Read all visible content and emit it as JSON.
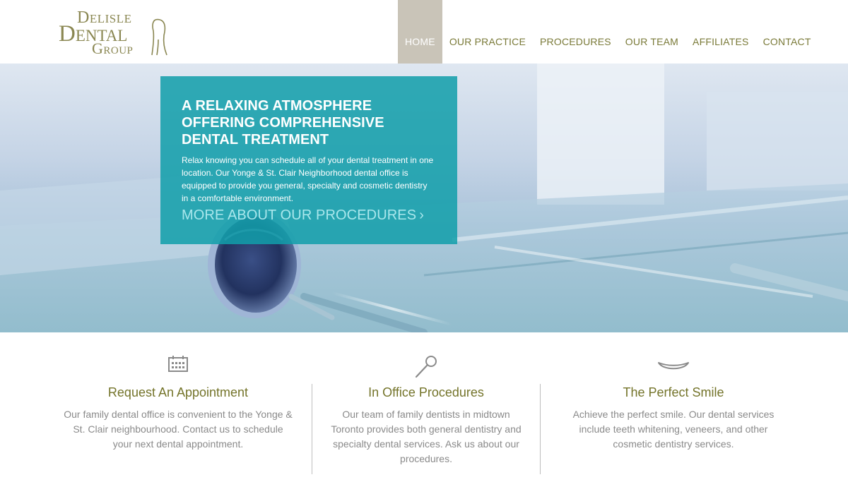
{
  "logo": {
    "line1": "Delisle",
    "line2": "Dental",
    "line3": "Group"
  },
  "nav": {
    "items": [
      {
        "label": "HOME",
        "active": true
      },
      {
        "label": "OUR PRACTICE",
        "active": false
      },
      {
        "label": "PROCEDURES",
        "active": false
      },
      {
        "label": "OUR TEAM",
        "active": false
      },
      {
        "label": "AFFILIATES",
        "active": false
      },
      {
        "label": "CONTACT",
        "active": false
      }
    ]
  },
  "hero": {
    "title": "A RELAXING ATMOSPHERE OFFERING COMPREHENSIVE DENTAL TREATMENT",
    "text": "Relax knowing you can schedule all of your dental treatment in one location. Our Yonge & St. Clair Neighborhood dental office is equipped to provide you general, specialty and cosmetic dentistry in a comfortable environment.",
    "link": "MORE ABOUT OUR PROCEDURES",
    "link_chevron": "›"
  },
  "features": [
    {
      "icon": "calendar-icon",
      "title": "Request An Appointment",
      "text": "Our family dental office is convenient to the Yonge & St. Clair neighbourhood. Contact us to schedule your next dental appointment."
    },
    {
      "icon": "dental-mirror-icon",
      "title": "In Office Procedures",
      "text": "Our team of family dentists in midtown Toronto provides both general dentistry and specialty dental services. Ask us about our procedures."
    },
    {
      "icon": "smile-icon",
      "title": "The Perfect Smile",
      "text": "Achieve the perfect smile. Our dental services include teeth whitening, veneers, and other cosmetic dentistry services."
    }
  ],
  "colors": {
    "accent_olive": "#74742a",
    "nav_active_bg": "#c9c4b8",
    "hero_box_teal": "#129eaa",
    "body_text_gray": "#8a8a8a"
  }
}
